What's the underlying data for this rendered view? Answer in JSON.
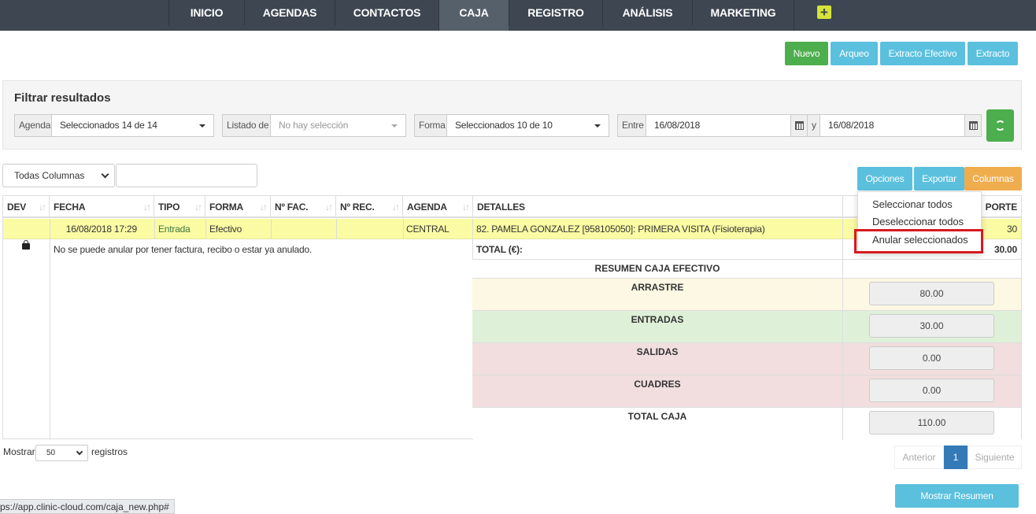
{
  "nav": {
    "items": [
      "INICIO",
      "AGENDAS",
      "CONTACTOS",
      "CAJA",
      "REGISTRO",
      "ANÁLISIS",
      "MARKETING"
    ],
    "active": "CAJA",
    "plus_icon": "+"
  },
  "actions": {
    "nuevo": "Nuevo",
    "arqueo": "Arqueo",
    "extracto_efectivo": "Extracto Efectivo",
    "extracto": "Extracto"
  },
  "filter": {
    "title": "Filtrar resultados",
    "agenda_label": "Agenda",
    "agenda_value": "Seleccionados 14 de 14",
    "listado_label": "Listado de",
    "listado_placeholder": "No hay selección",
    "forma_label": "Forma",
    "forma_value": "Seleccionados 10 de 10",
    "entre_label": "Entre",
    "date_from": "16/08/2018",
    "y_label": "y",
    "date_to": "16/08/2018"
  },
  "table_tools": {
    "columns_select": "Todas Columnas",
    "opciones": "Opciones",
    "exportar": "Exportar",
    "columnas": "Columnas"
  },
  "dropdown": {
    "items": [
      "Seleccionar todos",
      "Deseleccionar todos",
      "Anular seleccionados"
    ],
    "highlighted": "Anular seleccionados"
  },
  "table": {
    "headers": [
      "DEV",
      "FECHA",
      "TIPO",
      "FORMA",
      "Nº FAC.",
      "Nº REC.",
      "AGENDA",
      "DETALLES",
      "PORTE"
    ],
    "row": {
      "fecha": "16/08/2018 17:29",
      "tipo": "Entrada",
      "forma": "Efectivo",
      "fac": "",
      "rec": "",
      "agenda": "CENTRAL",
      "detalles": "82. PAMELA GONZALEZ [958105050]: PRIMERA VISITA (Fisioterapia)",
      "importe": "30"
    },
    "lock_note": "No se puede anular por tener factura, recibo o estar ya anulado.",
    "total_label": "TOTAL (€):",
    "total_value": "30.00"
  },
  "resumen": {
    "title": "RESUMEN CAJA EFECTIVO",
    "rows": [
      {
        "label": "ARRASTRE",
        "value": "80.00",
        "color": "#fcf8e3"
      },
      {
        "label": "ENTRADAS",
        "value": "30.00",
        "color": "#dff0d8"
      },
      {
        "label": "SALIDAS",
        "value": "0.00",
        "color": "#f2dede"
      },
      {
        "label": "CUADRES",
        "value": "0.00",
        "color": "#f2dede"
      },
      {
        "label": "TOTAL CAJA",
        "value": "110.00",
        "color": "#ffffff"
      }
    ]
  },
  "footer": {
    "mostrar": "Mostrar",
    "length": "50",
    "registros": "registros",
    "anterior": "Anterior",
    "page": "1",
    "siguiente": "Siguiente",
    "mostrar_resumen": "Mostrar Resumen"
  },
  "status_url": "ps://app.clinic-cloud.com/caja_new.php#",
  "colors": {
    "nav_bg": "#3d4651",
    "green": "#4cae4c",
    "cyan": "#5bc0de",
    "orange": "#f0ad4e",
    "highlight": "#fbfba4",
    "pager_active": "#337ab7"
  }
}
